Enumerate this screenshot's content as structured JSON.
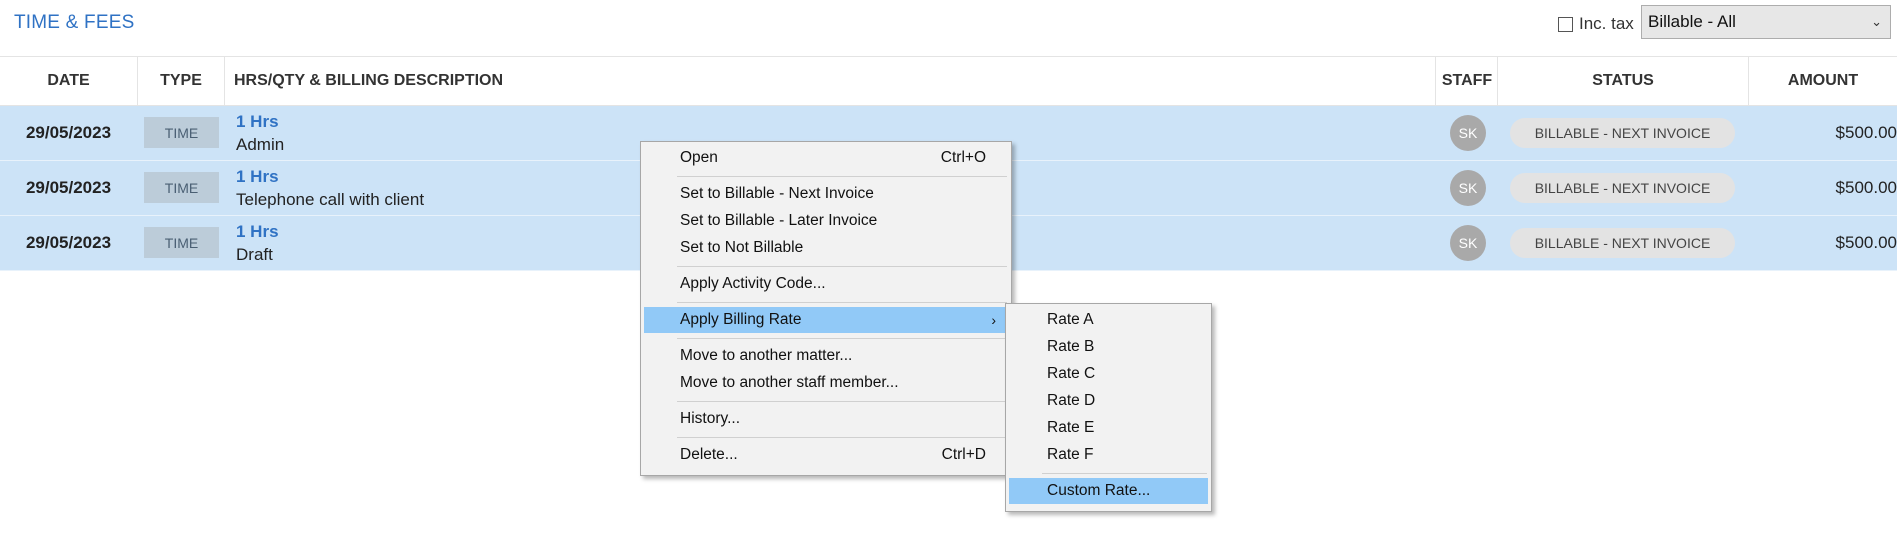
{
  "header": {
    "title": "TIME & FEES",
    "inc_tax_label": "Inc. tax",
    "filter_value": "Billable - All"
  },
  "columns": {
    "date": "DATE",
    "type": "TYPE",
    "description": "HRS/QTY & BILLING DESCRIPTION",
    "staff": "STAFF",
    "status": "STATUS",
    "amount": "AMOUNT"
  },
  "rows": [
    {
      "date": "29/05/2023",
      "type": "TIME",
      "hrs": "1 Hrs",
      "description": "Admin",
      "staff": "SK",
      "status": "BILLABLE - NEXT INVOICE",
      "amount": "$500.00"
    },
    {
      "date": "29/05/2023",
      "type": "TIME",
      "hrs": "1 Hrs",
      "description": "Telephone call with client",
      "staff": "SK",
      "status": "BILLABLE - NEXT INVOICE",
      "amount": "$500.00"
    },
    {
      "date": "29/05/2023",
      "type": "TIME",
      "hrs": "1 Hrs",
      "description": "Draft",
      "staff": "SK",
      "status": "BILLABLE - NEXT INVOICE",
      "amount": "$500.00"
    }
  ],
  "context_menu": {
    "open": "Open",
    "open_shortcut": "Ctrl+O",
    "set_next": "Set to Billable - Next Invoice",
    "set_later": "Set to Billable - Later Invoice",
    "set_not": "Set to Not Billable",
    "apply_activity": "Apply Activity Code...",
    "apply_rate": "Apply Billing Rate",
    "move_matter": "Move to another matter...",
    "move_staff": "Move to another staff member...",
    "history": "History...",
    "delete": "Delete...",
    "delete_shortcut": "Ctrl+D"
  },
  "rate_submenu": {
    "items": [
      "Rate A",
      "Rate B",
      "Rate C",
      "Rate D",
      "Rate E",
      "Rate F"
    ],
    "custom": "Custom Rate..."
  },
  "colors": {
    "accent": "#2f72c4",
    "row_selected": "#cce3f7",
    "menu_highlight": "#91c9f7"
  }
}
